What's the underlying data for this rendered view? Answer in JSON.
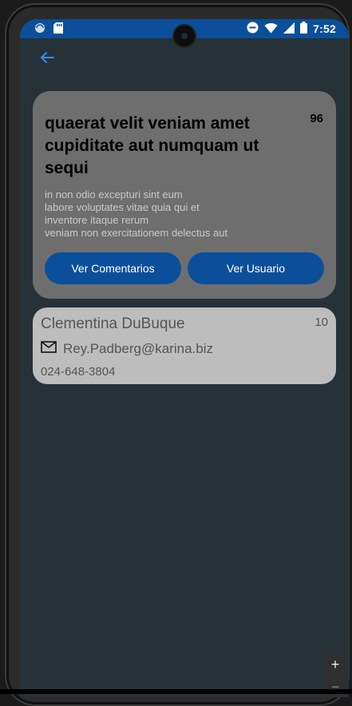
{
  "status_bar": {
    "time": "7:52",
    "icons_left": [
      "sync-icon",
      "sd-card-icon"
    ],
    "icons_right": [
      "do-not-disturb-icon",
      "wifi-icon",
      "signal-icon",
      "battery-icon"
    ],
    "color": "#0b4f9a"
  },
  "post": {
    "id": "96",
    "title": "quaerat velit veniam amet cupiditate aut numquam ut sequi",
    "body": "in non odio excepturi sint eum\nlabore voluptates vitae quia qui et\ninventore itaque rerum\nveniam non exercitationem delectus aut",
    "comments_button": "Ver Comentarios",
    "user_button": "Ver Usuario"
  },
  "user": {
    "name": "Clementina DuBuque",
    "id": "10",
    "email": "Rey.Padberg@karina.biz",
    "phone": "024-648-3804"
  },
  "zoom": {
    "plus": "+",
    "minus": "−"
  },
  "colors": {
    "background": "#263238",
    "accent": "#0b4f9a",
    "post_card": "#6e6e6e",
    "user_card": "#bdbdbd"
  }
}
